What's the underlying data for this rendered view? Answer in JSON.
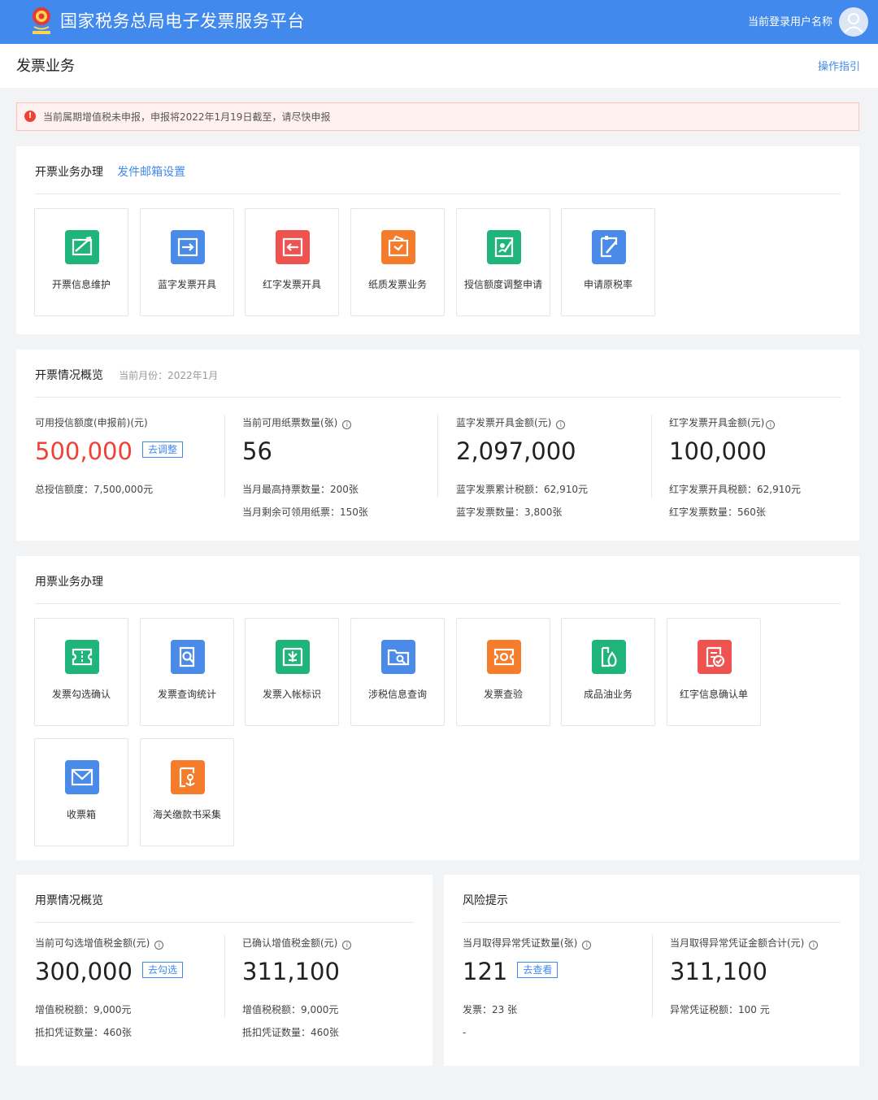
{
  "header": {
    "title": "国家税务总局电子发票服务平台",
    "user_name": "当前登录用户名称"
  },
  "page": {
    "title": "发票业务",
    "guide_link": "操作指引"
  },
  "alert": {
    "text": "当前属期增值税未申报，申报将2022年1月19日截至，请尽快申报"
  },
  "issue_business": {
    "title": "开票业务办理",
    "mail_link": "发件邮箱设置",
    "tiles": [
      {
        "label": "开票信息维护",
        "color": "#1fb57a"
      },
      {
        "label": "蓝字发票开具",
        "color": "#4a8ae8"
      },
      {
        "label": "红字发票开具",
        "color": "#ef5350"
      },
      {
        "label": "纸质发票业务",
        "color": "#f57c2b"
      },
      {
        "label": "授信额度调整申请",
        "color": "#1fb57a"
      },
      {
        "label": "申请原税率",
        "color": "#4a8ae8"
      }
    ]
  },
  "issue_overview": {
    "title": "开票情况概览",
    "current_month": "当前月份：2022年1月",
    "stats": [
      {
        "label": "可用授信额度(申报前)(元)",
        "value": "500,000",
        "button": "去调整",
        "detail1": "总授信额度：7,500,000元"
      },
      {
        "label": "当前可用纸票数量(张)",
        "value": "56",
        "detail1": "当月最高持票数量：200张",
        "detail2": "当月剩余可领用纸票：150张"
      },
      {
        "label": "蓝字发票开具金额(元)",
        "value": "2,097,000",
        "detail1": "蓝字发票累计税额：62,910元",
        "detail2": "蓝字发票数量：3,800张"
      },
      {
        "label": "红字发票开具金额(元)",
        "value": "100,000",
        "detail1": "红字发票开具税额：62,910元",
        "detail2": "红字发票数量：560张"
      }
    ]
  },
  "use_business": {
    "title": "用票业务办理",
    "tiles": [
      {
        "label": "发票勾选确认",
        "color": "#1fb57a"
      },
      {
        "label": "发票查询统计",
        "color": "#4a8ae8"
      },
      {
        "label": "发票入帐标识",
        "color": "#1fb57a"
      },
      {
        "label": "涉税信息查询",
        "color": "#4a8ae8"
      },
      {
        "label": "发票查验",
        "color": "#f57c2b"
      },
      {
        "label": "成品油业务",
        "color": "#1fb57a"
      },
      {
        "label": "红字信息确认单",
        "color": "#ef5350"
      },
      {
        "label": "收票箱",
        "color": "#4a8ae8"
      },
      {
        "label": "海关缴款书采集",
        "color": "#f57c2b"
      }
    ]
  },
  "use_overview": {
    "title": "用票情况概览",
    "stats": [
      {
        "label": "当前可勾选增值税金额(元)",
        "value": "300,000",
        "button": "去勾选",
        "detail1": "增值税税额：9,000元",
        "detail2": "抵扣凭证数量：460张"
      },
      {
        "label": "已确认增值税金额(元)",
        "value": "311,100",
        "detail1": "增值税税额：9,000元",
        "detail2": "抵扣凭证数量：460张"
      }
    ]
  },
  "risk": {
    "title": "风险提示",
    "stats": [
      {
        "label": "当月取得异常凭证数量(张)",
        "value": "121",
        "button": "去查看",
        "detail1": "发票：23 张",
        "detail2": "-"
      },
      {
        "label": "当月取得异常凭证金额合计(元)",
        "value": "311,100",
        "detail1": "异常凭证税额：100 元"
      }
    ]
  }
}
